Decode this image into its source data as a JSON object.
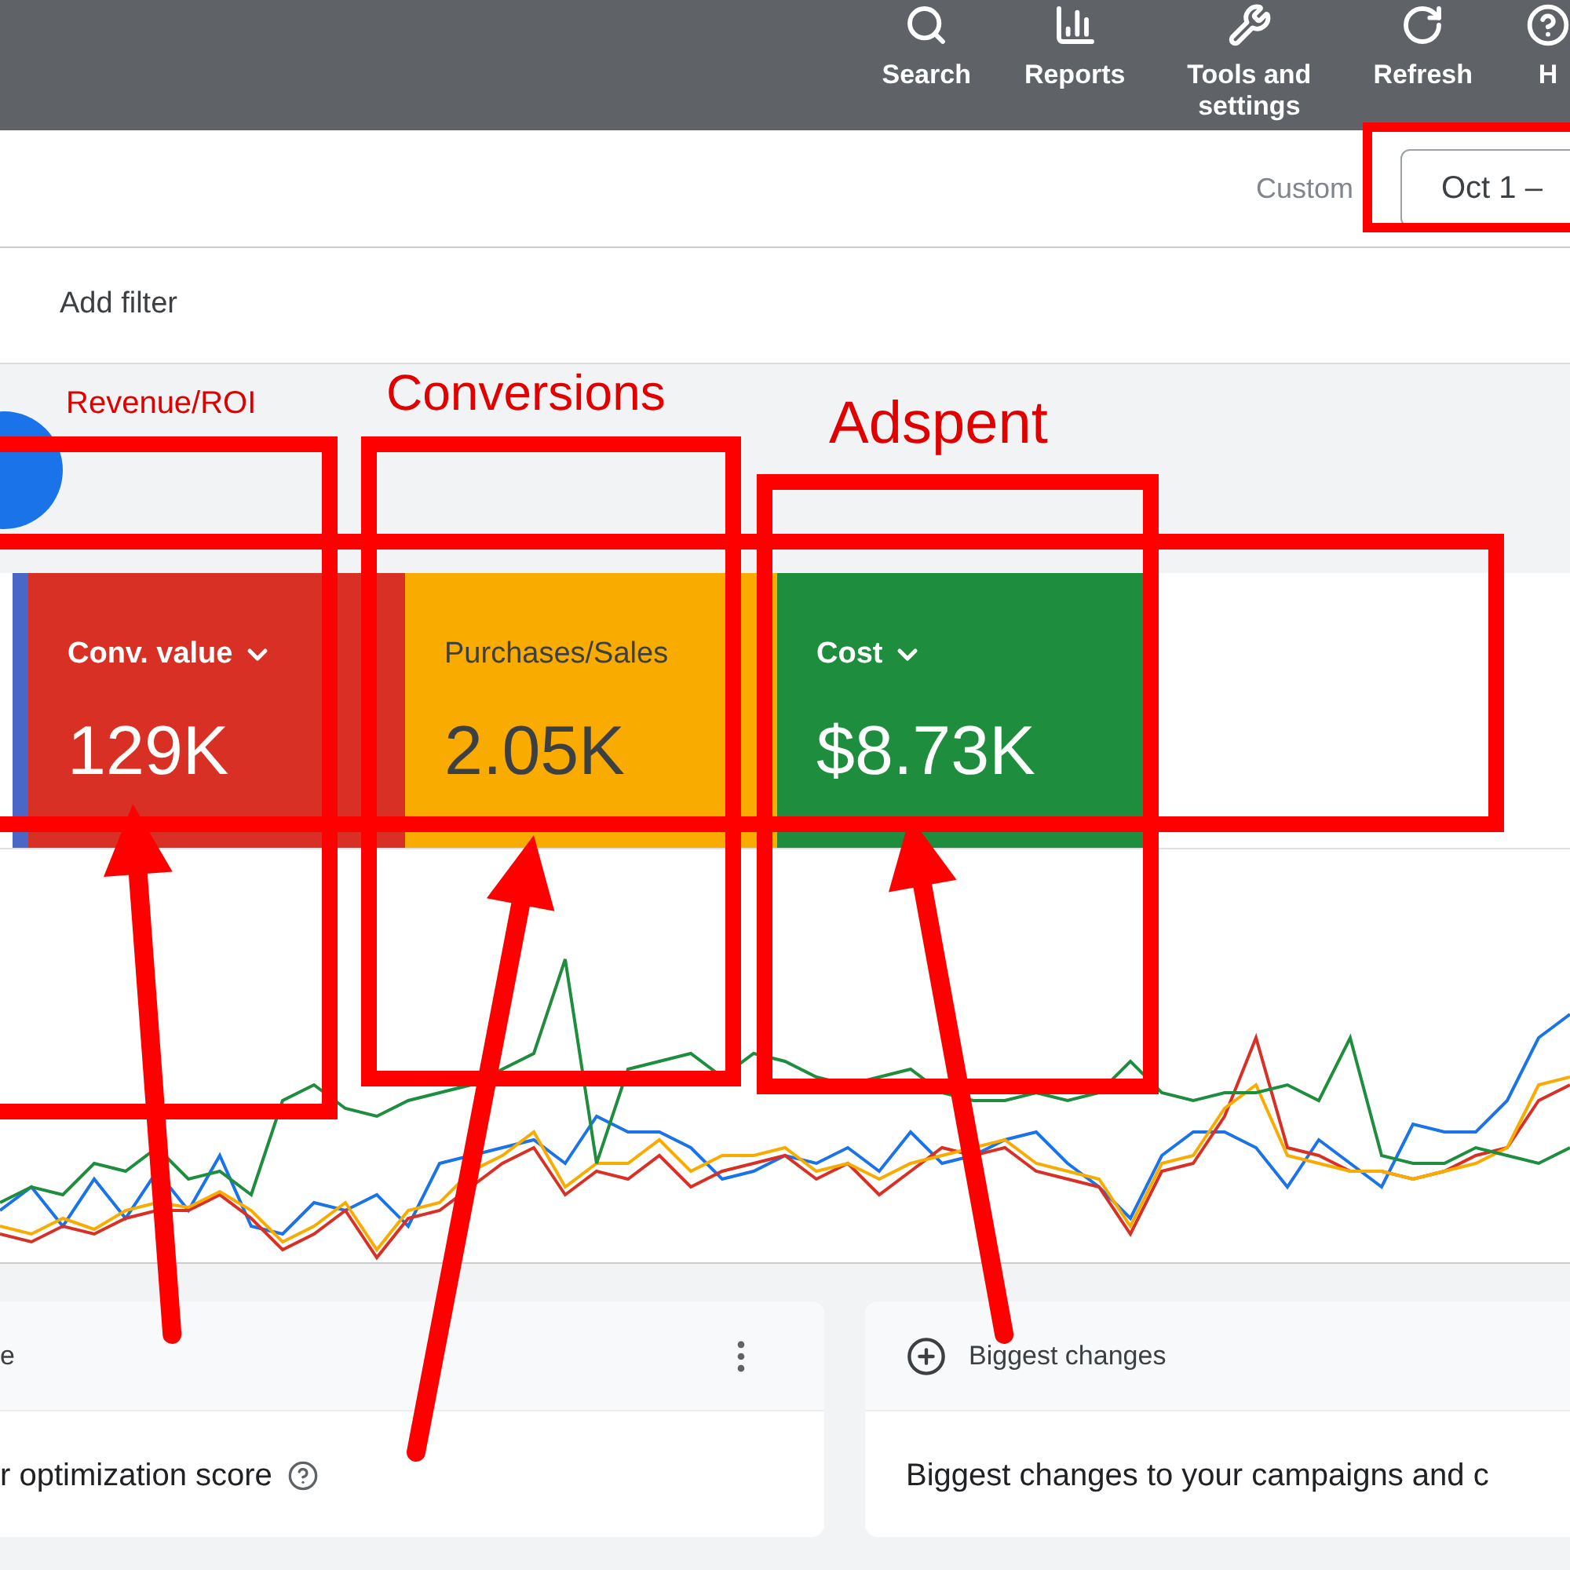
{
  "top_nav": {
    "items": [
      {
        "label": "Search",
        "kind": "search"
      },
      {
        "label": "Reports",
        "kind": "reports"
      },
      {
        "label": "Tools and settings",
        "kind": "tools"
      },
      {
        "label": "Refresh",
        "kind": "refresh"
      },
      {
        "label": "H",
        "kind": "help"
      }
    ]
  },
  "date_bar": {
    "range_type": "Custom",
    "date_range": "Oct 1 –"
  },
  "filter_bar": {
    "add_filter": "Add filter"
  },
  "annotations": [
    "Revenue/ROI",
    "Conversions",
    "Adspent"
  ],
  "metric_cards": [
    {
      "label": "Conv. value",
      "dropdown": true,
      "value": "129K",
      "color": "#d93025",
      "dark_text": false
    },
    {
      "label": "Purchases/Sales",
      "dropdown": false,
      "value": "2.05K",
      "color": "#f9ab00",
      "dark_text": true
    },
    {
      "label": "Cost",
      "dropdown": true,
      "value": "$8.73K",
      "color": "#1e8e3e",
      "dark_text": false
    }
  ],
  "cards": [
    {
      "title": "e",
      "menu": true,
      "body": "r optimization score",
      "help": true,
      "icon": false
    },
    {
      "title": "Biggest changes",
      "menu": false,
      "body": "Biggest changes to your campaigns and c",
      "help": false,
      "icon": true
    }
  ]
}
